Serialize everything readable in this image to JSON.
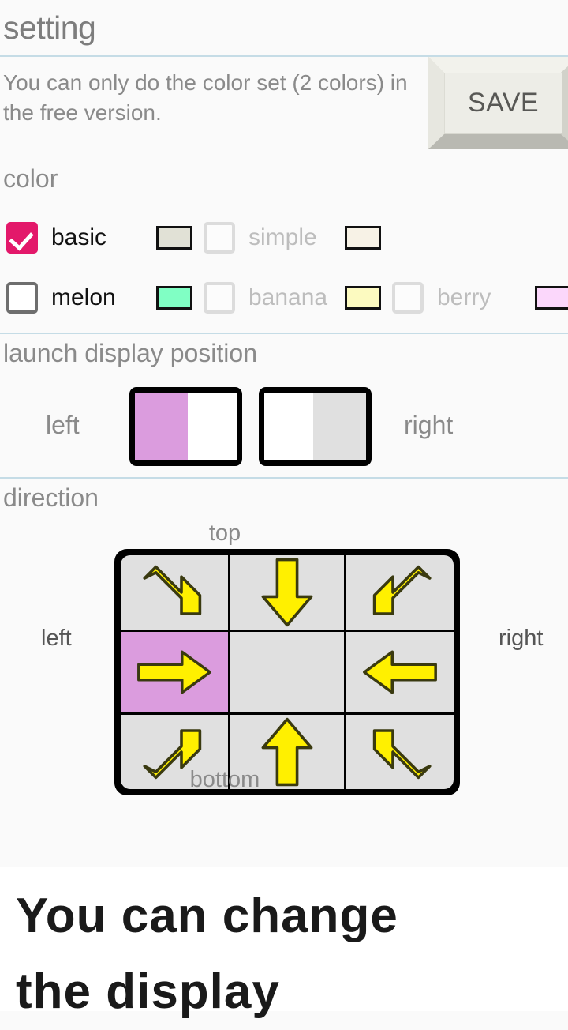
{
  "header": {
    "title": "setting"
  },
  "notice": {
    "text": "You can only do the color set (2 colors) in the free version."
  },
  "toolbar": {
    "save_label": "SAVE"
  },
  "color_section": {
    "label": "color",
    "rows": [
      {
        "items": [
          {
            "name": "basic",
            "checked": true,
            "enabled": true,
            "swatches": []
          },
          {
            "name": "simple",
            "checked": false,
            "enabled": false,
            "swatches": [
              "#E1E1D6",
              "#F7F2E6"
            ]
          }
        ]
      },
      {
        "items": [
          {
            "name": "melon",
            "checked": false,
            "enabled": true,
            "swatches": []
          },
          {
            "name": "banana",
            "checked": false,
            "enabled": false,
            "swatches": [
              "#80FFC4"
            ]
          },
          {
            "name": "berry",
            "checked": false,
            "enabled": false,
            "swatches": [
              "#FCFAC0"
            ]
          },
          {
            "name": "",
            "checked": false,
            "enabled": false,
            "swatches": [
              "#FBD7FB"
            ]
          }
        ]
      }
    ],
    "swatch_basic": "#E1E1D6",
    "swatch_basic2": "#F7F2E6",
    "swatch_melon": "#80FFC4",
    "swatch_banana": "#FCFAC0",
    "swatch_berry": "#FBD7FB",
    "checked_color": "#E3186A"
  },
  "launch_section": {
    "label": "launch display position",
    "left_label": "left",
    "right_label": "right",
    "selected": "left",
    "accent_color": "#DB9CDE"
  },
  "direction_section": {
    "label": "direction",
    "top_label": "top",
    "bottom_label": "bottom",
    "left_label": "left",
    "right_label": "right",
    "selected_index": 3,
    "accent_color": "#DB9CDE",
    "arrow_color": "#FFF000",
    "cells": [
      {
        "direction": "down-right",
        "arrow": true,
        "selected": false
      },
      {
        "direction": "down",
        "arrow": true,
        "selected": false
      },
      {
        "direction": "down-left",
        "arrow": true,
        "selected": false
      },
      {
        "direction": "right",
        "arrow": true,
        "selected": true
      },
      {
        "direction": "none",
        "arrow": false,
        "selected": false
      },
      {
        "direction": "left",
        "arrow": true,
        "selected": false
      },
      {
        "direction": "up-right",
        "arrow": true,
        "selected": false
      },
      {
        "direction": "up",
        "arrow": true,
        "selected": false
      },
      {
        "direction": "up-left",
        "arrow": true,
        "selected": false
      }
    ]
  },
  "footer": {
    "line1": "You can change",
    "line2": "the display"
  }
}
